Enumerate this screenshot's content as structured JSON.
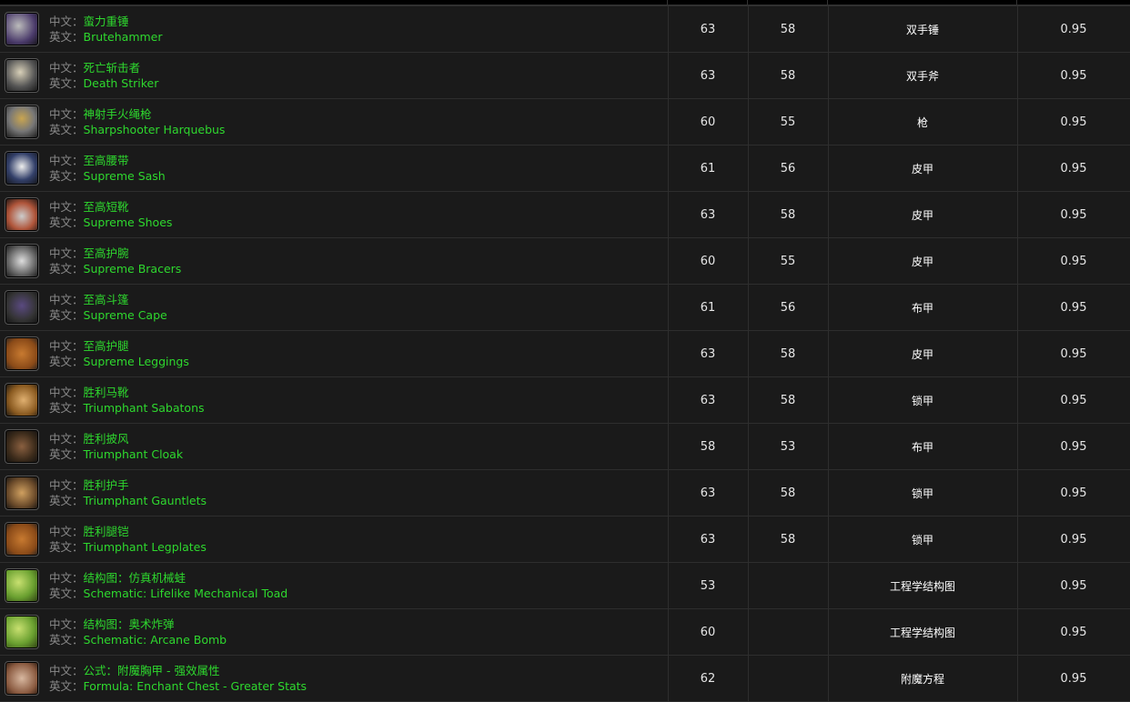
{
  "labels": {
    "cn": "中文：",
    "en": "英文："
  },
  "colors": {
    "item_name": "#2ed82e",
    "label": "#8a8a8a",
    "background": "#1a1a1a"
  },
  "rows": [
    {
      "icon": "two-handed-mace-icon",
      "cn": "蛮力重锤",
      "en": "Brutehammer",
      "a": "63",
      "b": "58",
      "type": "双手锤",
      "rate": "0.95"
    },
    {
      "icon": "two-handed-axe-icon",
      "cn": "死亡斩击者",
      "en": "Death Striker",
      "a": "63",
      "b": "58",
      "type": "双手斧",
      "rate": "0.95"
    },
    {
      "icon": "gun-icon",
      "cn": "神射手火绳枪",
      "en": "Sharpshooter Harquebus",
      "a": "60",
      "b": "55",
      "type": "枪",
      "rate": "0.95"
    },
    {
      "icon": "belt-icon",
      "cn": "至高腰带",
      "en": "Supreme Sash",
      "a": "61",
      "b": "56",
      "type": "皮甲",
      "rate": "0.95"
    },
    {
      "icon": "boots-icon",
      "cn": "至高短靴",
      "en": "Supreme Shoes",
      "a": "63",
      "b": "58",
      "type": "皮甲",
      "rate": "0.95"
    },
    {
      "icon": "bracers-icon",
      "cn": "至高护腕",
      "en": "Supreme Bracers",
      "a": "60",
      "b": "55",
      "type": "皮甲",
      "rate": "0.95"
    },
    {
      "icon": "cape-icon",
      "cn": "至高斗篷",
      "en": "Supreme Cape",
      "a": "61",
      "b": "56",
      "type": "布甲",
      "rate": "0.95"
    },
    {
      "icon": "leggings-icon",
      "cn": "至高护腿",
      "en": "Supreme Leggings",
      "a": "63",
      "b": "58",
      "type": "皮甲",
      "rate": "0.95"
    },
    {
      "icon": "sabatons-icon",
      "cn": "胜利马靴",
      "en": "Triumphant Sabatons",
      "a": "63",
      "b": "58",
      "type": "锁甲",
      "rate": "0.95"
    },
    {
      "icon": "cloak-icon",
      "cn": "胜利披风",
      "en": "Triumphant Cloak",
      "a": "58",
      "b": "53",
      "type": "布甲",
      "rate": "0.95"
    },
    {
      "icon": "gauntlets-icon",
      "cn": "胜利护手",
      "en": "Triumphant Gauntlets",
      "a": "63",
      "b": "58",
      "type": "锁甲",
      "rate": "0.95"
    },
    {
      "icon": "legplates-icon",
      "cn": "胜利腿铠",
      "en": "Triumphant Legplates",
      "a": "63",
      "b": "58",
      "type": "锁甲",
      "rate": "0.95"
    },
    {
      "icon": "schematic-icon",
      "cn": "结构图：仿真机械蛙",
      "en": "Schematic: Lifelike Mechanical Toad",
      "a": "53",
      "b": "",
      "type": "工程学结构图",
      "rate": "0.95"
    },
    {
      "icon": "schematic-icon",
      "cn": "结构图：奥术炸弹",
      "en": "Schematic: Arcane Bomb",
      "a": "60",
      "b": "",
      "type": "工程学结构图",
      "rate": "0.95"
    },
    {
      "icon": "formula-scroll-icon",
      "cn": "公式：附魔胸甲 - 强效属性",
      "en": "Formula: Enchant Chest - Greater Stats",
      "a": "62",
      "b": "",
      "type": "附魔方程",
      "rate": "0.95"
    }
  ]
}
